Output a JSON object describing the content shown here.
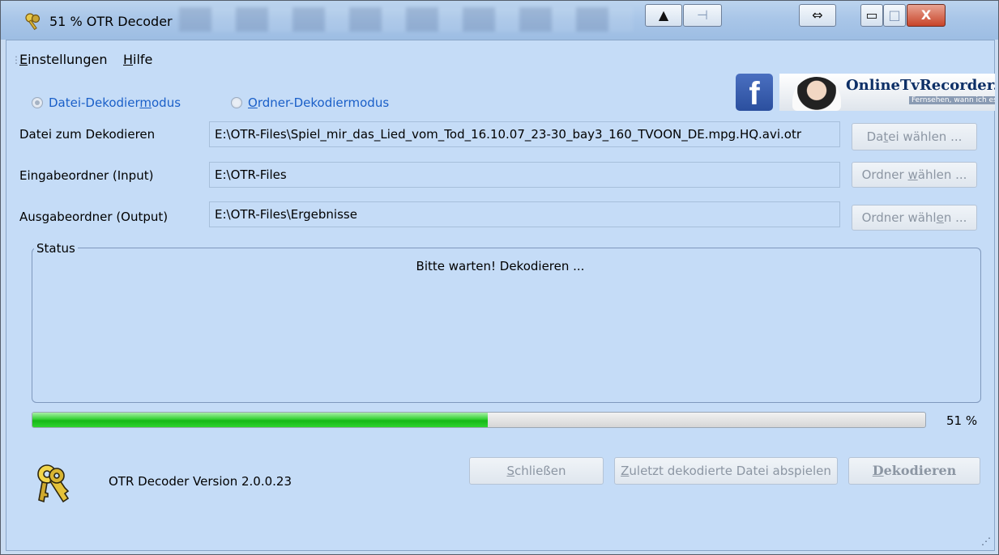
{
  "window": {
    "title": "51 % OTR Decoder",
    "controls": {
      "up_arrow": "▲",
      "pin": "⊣",
      "resize": "⇔",
      "minimize": "▭",
      "maximize": "□",
      "close": "X"
    }
  },
  "menu": {
    "items": [
      {
        "key": "E",
        "rest": "instellungen"
      },
      {
        "key": "H",
        "rest": "ilfe"
      }
    ]
  },
  "mode": {
    "file_mode": {
      "before": "Datei-Dekodier",
      "key": "m",
      "after": "odus",
      "checked": true
    },
    "folder_mode": {
      "before": "",
      "key": "O",
      "after": "rdner-Dekodiermodus",
      "checked": false
    }
  },
  "banner": {
    "facebook": "f",
    "otr_name": "OnlineTvRecorder.com",
    "otr_slogan": "Fernsehen, wann ich es will"
  },
  "rows": {
    "file": {
      "label": "Datei zum Dekodieren",
      "value": "E:\\OTR-Files\\Spiel_mir_das_Lied_vom_Tod_16.10.07_23-30_bay3_160_TVOON_DE.mpg.HQ.avi.otr",
      "button_before": "Da",
      "button_key": "t",
      "button_after": "ei wählen ..."
    },
    "input": {
      "label": "Eingabeordner (Input)",
      "value": "E:\\OTR-Files",
      "button_before": "Ordner ",
      "button_key": "w",
      "button_after": "ählen ..."
    },
    "output": {
      "label": "Ausgabeordner (Output)",
      "value": "E:\\OTR-Files\\Ergebnisse",
      "button_before": "Ordner wähl",
      "button_key": "e",
      "button_after": "n ..."
    }
  },
  "status": {
    "legend": "Status",
    "message": "Bitte warten! Dekodieren ..."
  },
  "progress": {
    "value": 0.51,
    "label": "51 %"
  },
  "footer": {
    "version": "OTR Decoder Version 2.0.0.23",
    "close_key": "S",
    "close_rest": "chließen",
    "play_key": "Z",
    "play_rest": "uletzt dekodierte Datei abspielen",
    "decode_key": "D",
    "decode_rest": "ekodieren",
    "resize_grip": "⋰"
  },
  "colors": {
    "window_bg": "#c5dcf7",
    "accent_blue": "#1a5fc8",
    "progress_green": "#22c422",
    "disabled_text": "#8c96a3"
  }
}
